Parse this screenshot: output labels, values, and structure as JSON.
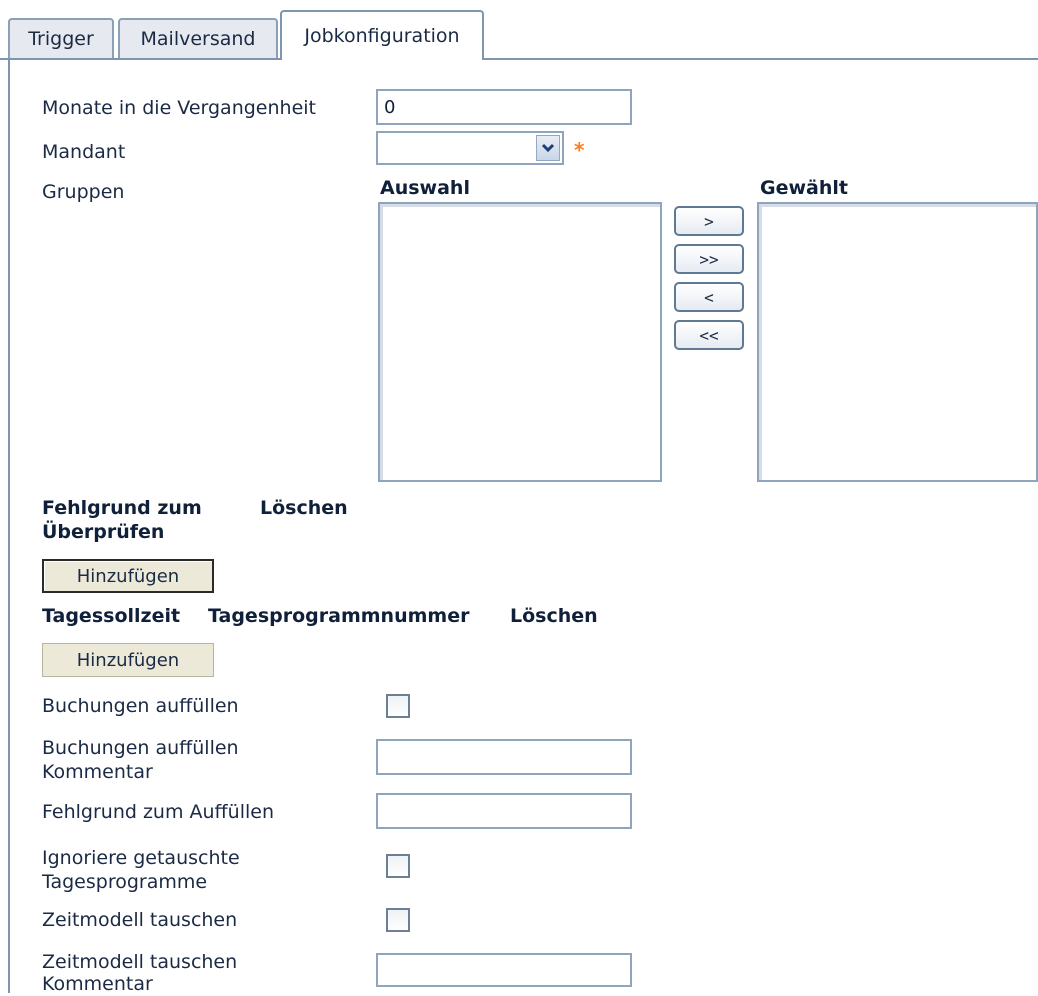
{
  "tabs": [
    {
      "label": "Trigger"
    },
    {
      "label": "Mailversand"
    },
    {
      "label": "Jobkonfiguration"
    }
  ],
  "form": {
    "monate_label": "Monate in die Vergangenheit",
    "monate_value": "0",
    "mandant_label": "Mandant",
    "mandant_value": "",
    "required_mark": "*",
    "gruppen_label": "Gruppen",
    "auswahl_header": "Auswahl",
    "gewaehlt_header": "Gewählt",
    "move_buttons": [
      ">",
      ">>",
      "<",
      "<<"
    ],
    "fehlgrund_header_1": "Fehlgrund zum",
    "fehlgrund_header_2": "Überprüfen",
    "loeschen_header": "Löschen",
    "add_button_1": "Hinzufügen",
    "tages_headers": [
      "Tagessollzeit",
      "Tagesprogrammnummer",
      "Löschen"
    ],
    "add_button_2": "Hinzufügen",
    "buchungen_label": "Buchungen auffüllen",
    "buchungen_checked": false,
    "buchungen_kommentar_label_1": "Buchungen auffüllen",
    "buchungen_kommentar_label_2": "Kommentar",
    "buchungen_kommentar_value": "",
    "fehlgrund_auffuellen_label": "Fehlgrund zum Auffüllen",
    "fehlgrund_auffuellen_value": "",
    "ignoriere_label_1": "Ignoriere getauschte",
    "ignoriere_label_2": "Tagesprogramme",
    "ignoriere_checked": false,
    "zeitmodell_label": "Zeitmodell tauschen",
    "zeitmodell_checked": false,
    "zeitmodell_kommentar_label_1": "Zeitmodell tauschen",
    "zeitmodell_kommentar_label_2": "Kommentar",
    "zeitmodell_kommentar_value": ""
  },
  "colors": {
    "border": "#8ea5bd",
    "text": "#1b2a44",
    "required": "#ff7a1a",
    "button_bg": "#ece9d8"
  }
}
